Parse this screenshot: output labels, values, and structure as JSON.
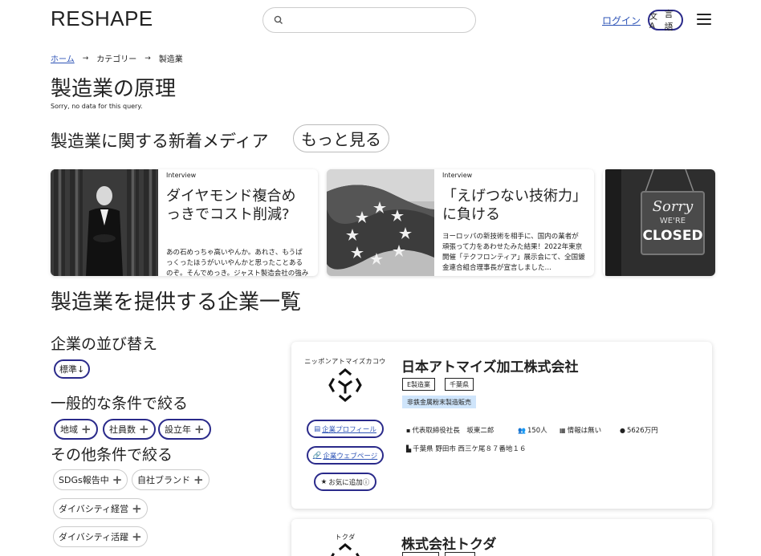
{
  "header": {
    "logo": "RESHAPE",
    "search_placeholder": "",
    "login": "ログイン",
    "lang_label": "言語",
    "lang_icon": "文A"
  },
  "breadcrumb": [
    "ホーム",
    "カテゴリー",
    "製造業"
  ],
  "page_title": "製造業の原理",
  "no_data": "Sorry, no data for this query.",
  "media": {
    "heading": "製造業に関する新着メディア",
    "more_label": "もっと見る",
    "cards": [
      {
        "tag": "Interview",
        "title": "ダイヤモンド複合めっきでコスト削減?",
        "desc": "あの石めっちゃ高いやんか。あれさ、もうぱっくったほうがいいやんかと思ったことあるのぞ。そんでめっき。ジャスト製造会社の強みを生かして…"
      },
      {
        "tag": "Interview",
        "title": "「えげつない技術力」に負ける",
        "desc": "ヨーロッパの新技術を相手に、国内の業者が頑張って力をあわせたみた結果！2022年東京開催「テクフロンティア」展示会にて、全国鍍金連合組合理事長が宣言しました…"
      },
      {
        "tag": "",
        "title": "",
        "desc": ""
      }
    ],
    "card3_sign": [
      "Sorry",
      "WE'RE",
      "CLOSED"
    ]
  },
  "companies_title": "製造業を提供する企業一覧",
  "filters": {
    "sort_heading": "企業の並び替え",
    "sort_value": "標準↓",
    "general_heading": "一般的な条件で絞る",
    "general_chips": [
      "地域",
      "社員数",
      "設立年"
    ],
    "other_heading": "その他条件で絞る",
    "other_chips": [
      "SDGs報告中",
      "自社ブランド",
      "ダイバシティ経営",
      "ダイバシティ活躍"
    ]
  },
  "companies": [
    {
      "kana": "ニッポンアトマイズカコウ",
      "name": "日本アトマイズ加工株式会社",
      "tags": [
        "E製造業",
        "千葉県"
      ],
      "highlight": "非鉄金属粉末製造販売",
      "profile_btn": "企業プロフィール",
      "web_btn": "企業ウェブページ",
      "fav_btn": "お気に追加ⓘ",
      "rep": "代表取締役社長　坂東二郎",
      "employees": "150人",
      "info": "情報は無い",
      "capital": "5626万円",
      "address": "千葉県 野田市 西三ケ尾８７番地１６"
    },
    {
      "kana": "トクダ",
      "name": "株式会社トクダ"
    }
  ]
}
